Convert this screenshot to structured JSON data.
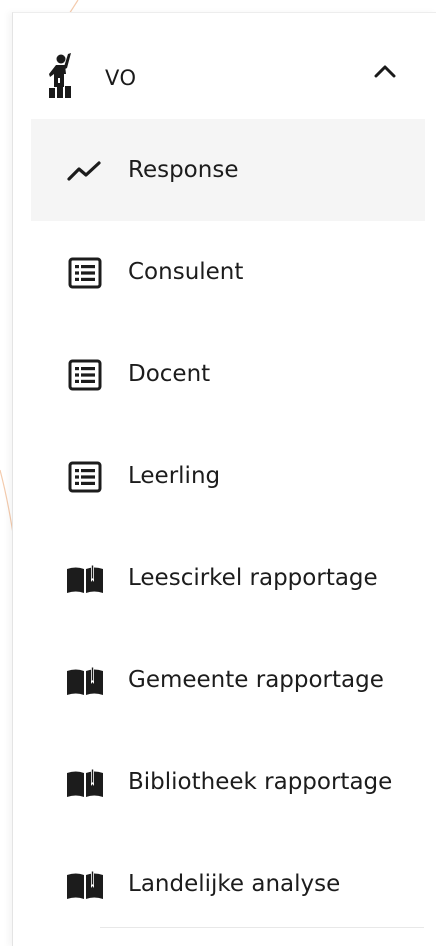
{
  "group": {
    "label": "VO",
    "icon": "person-raising-hand-icon",
    "expanded": true,
    "toggle_icon": "chevron-up-icon"
  },
  "menu": {
    "items": [
      {
        "label": "Response",
        "icon": "trend-line-icon",
        "active": true
      },
      {
        "label": "Consulent",
        "icon": "list-document-icon",
        "active": false
      },
      {
        "label": "Docent",
        "icon": "list-document-icon",
        "active": false
      },
      {
        "label": "Leerling",
        "icon": "list-document-icon",
        "active": false
      },
      {
        "label": "Leescirkel rapportage",
        "icon": "open-book-icon",
        "active": false
      },
      {
        "label": "Gemeente rapportage",
        "icon": "open-book-icon",
        "active": false
      },
      {
        "label": "Bibliotheek rapportage",
        "icon": "open-book-icon",
        "active": false
      },
      {
        "label": "Landelijke analyse",
        "icon": "open-book-icon",
        "active": false
      }
    ]
  },
  "colors": {
    "text": "#1c1c1c",
    "active_background": "#f5f5f5",
    "decoration_line": "#f0b58a"
  }
}
